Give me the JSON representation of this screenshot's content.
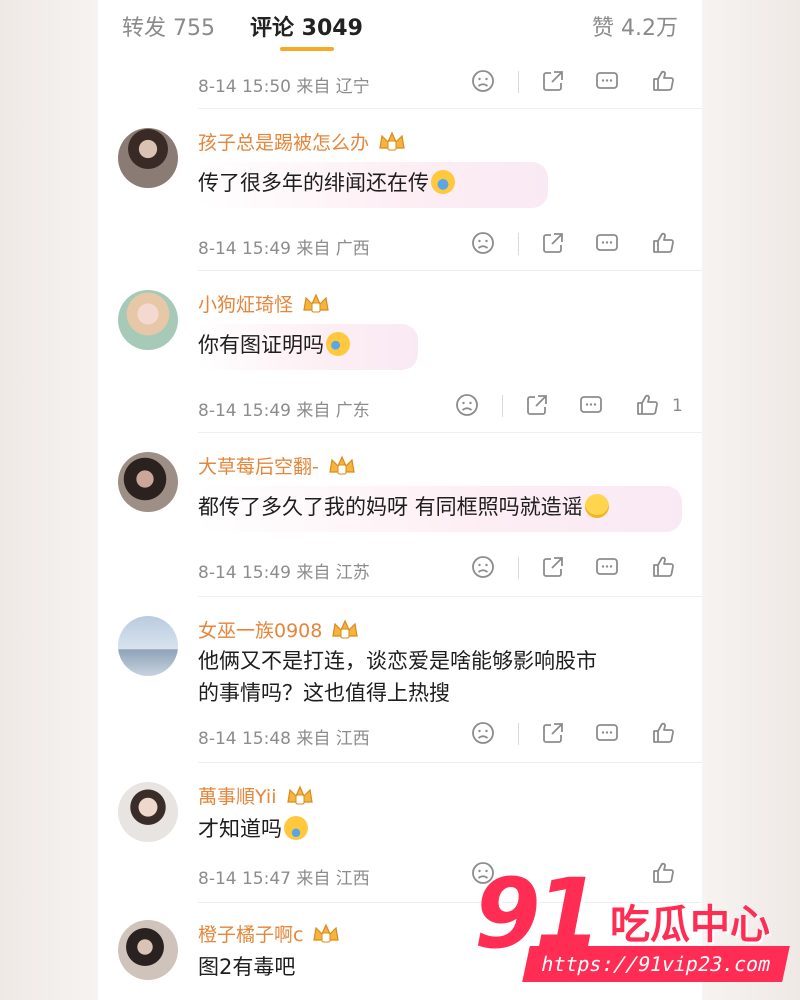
{
  "tabs": {
    "repost": "转发 755",
    "comment": "评论 3049",
    "like": "赞 4.2万"
  },
  "first_meta": {
    "meta": "8-14 15:50 来自 辽宁"
  },
  "comments": [
    {
      "username": "孩子总是踢被怎么办",
      "text": "传了很多年的绯闻还在传",
      "meta": "8-14 15:49 来自 广西",
      "likes": ""
    },
    {
      "username": "小狗炡琦怪",
      "text": "你有图证明吗",
      "meta": "8-14 15:49 来自 广东",
      "likes": "1"
    },
    {
      "username": "大草莓后空翻-",
      "text": "都传了多久了我的妈呀 有同框照吗就造谣",
      "meta": "8-14 15:49 来自 江苏",
      "likes": ""
    },
    {
      "username": "女巫一族0908",
      "text_line1": "他俩又不是打连，谈恋爱是啥能够影响股市",
      "text_line2": "的事情吗？这也值得上热搜",
      "meta": "8-14 15:48 来自 江西",
      "likes": ""
    },
    {
      "username": "萬事順Yii",
      "text": "才知道吗",
      "meta": "8-14 15:47 来自 江西",
      "likes": ""
    },
    {
      "username": "橙子橘子啊c",
      "text": "图2有毒吧"
    }
  ],
  "watermark": {
    "number": "91",
    "name": "吃瓜中心",
    "url": "https://91vip23.com"
  },
  "colors": {
    "accent": "#f7a928",
    "username": "#e5863a",
    "watermark": "#ff2d54"
  },
  "icons": [
    "dislike-icon",
    "share-icon",
    "comment-icon",
    "like-icon",
    "crown-badge-icon"
  ]
}
